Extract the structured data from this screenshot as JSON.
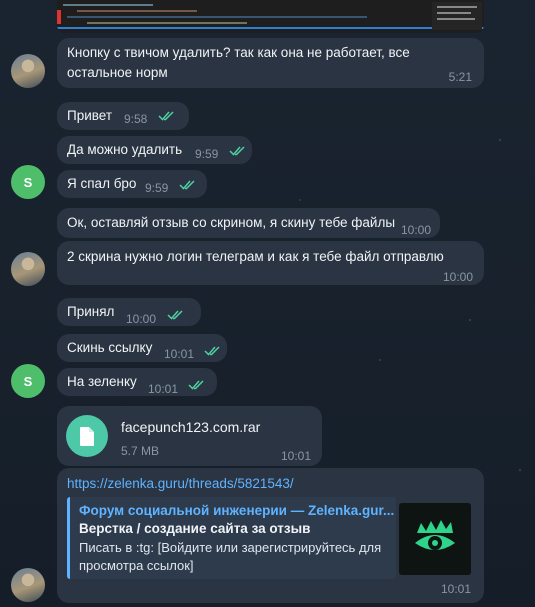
{
  "messages": [
    {
      "text": "Кнопку с твичом удалить? так как она не работает, все",
      "text2": "остальное норм",
      "time": "5:21"
    },
    {
      "text": "Привет",
      "time": "9:58"
    },
    {
      "text": "Да можно удалить",
      "time": "9:59"
    },
    {
      "text": "Я спал бро",
      "time": "9:59"
    },
    {
      "text": "Ок, оставляй отзыв со скрином, я скину тебе файлы",
      "time": "10:00"
    },
    {
      "text": "2 скрина нужно логин телеграм и как я тебе файл отправлю",
      "time": "10:00"
    },
    {
      "text": "Принял",
      "time": "10:00"
    },
    {
      "text": "Скинь ссылку",
      "time": "10:01"
    },
    {
      "text": "На зеленку",
      "time": "10:01"
    }
  ],
  "file": {
    "name": "facepunch123.com.rar",
    "size": "5.7 MB",
    "time": "10:01"
  },
  "link_message": {
    "url": "https://zelenka.guru/threads/5821543/",
    "site": "Форум социальной инженерии — Zelenka.gur...",
    "title": "Верстка / создание сайта за отзыв",
    "desc1": "Писать в :tg: [Войдите или зарегистрируйтесь для",
    "desc2": "просмотра ссылок]",
    "time": "10:01"
  },
  "avatars": {
    "user_letter": "S"
  },
  "colors": {
    "accent": "#5fb3ff",
    "check": "#4fd1a0",
    "avatar_green": "#4fbe6b"
  }
}
